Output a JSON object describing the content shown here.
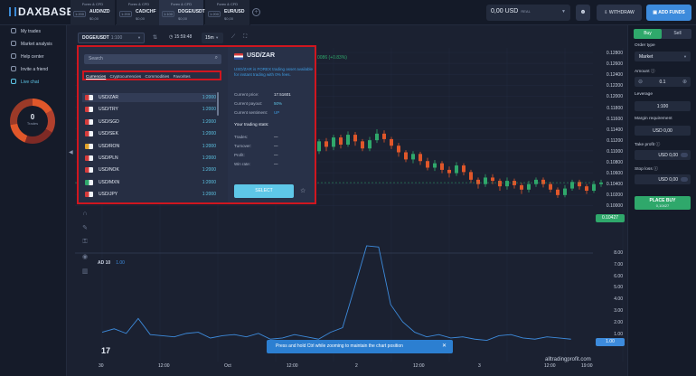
{
  "brand": {
    "logo_text": "DAXBASE"
  },
  "asset_tabs": [
    {
      "category": "Forex & CFD",
      "leverage": "1:200",
      "name": "AUD/NZD",
      "amount": "$0,00",
      "active": false
    },
    {
      "category": "Forex & CFD",
      "leverage": "1:200",
      "name": "CAD/CHF",
      "amount": "$0,00",
      "active": false
    },
    {
      "category": "Forex & CFD",
      "leverage": "1:100",
      "name": "DOGE/USDT",
      "amount": "$0,00",
      "active": true
    },
    {
      "category": "Forex & CFD",
      "leverage": "1:200",
      "name": "EUR/USD",
      "amount": "$0,00",
      "active": false
    }
  ],
  "header": {
    "balance": "0,00 USD",
    "balance_type": "REAL",
    "withdraw_label": "WITHDRAW",
    "add_funds_label": "ADD FUNDS"
  },
  "leftnav": {
    "items": [
      {
        "label": "My trades",
        "icon": "briefcase-icon"
      },
      {
        "label": "Market analysis",
        "icon": "chart-icon"
      },
      {
        "label": "Help center",
        "icon": "question-icon"
      },
      {
        "label": "Invite a friend",
        "icon": "user-plus-icon"
      },
      {
        "label": "Live chat",
        "icon": "chat-icon"
      }
    ],
    "trades_count": "0",
    "trades_label": "Trades"
  },
  "chart": {
    "pair_select": "DOGE/USDT",
    "pair_leverage": "1:100",
    "clock": "15:59:48",
    "timeframe": "15m",
    "price_ticks": [
      "0.12800",
      "0.12600",
      "0.12400",
      "0.12200",
      "0.12000",
      "0.11800",
      "0.11600",
      "0.11400",
      "0.11200",
      "0.11000",
      "0.10800",
      "0.10600",
      "0.10400",
      "0.10200",
      "0.10000"
    ],
    "price_badge": "0.10427",
    "ad_ticks": [
      "8.00",
      "7.00",
      "6.00",
      "5.00",
      "4.00",
      "3.00",
      "2.00",
      "1.00",
      "0.00"
    ],
    "ad_badge": "1.00",
    "ad_label": "AD 10",
    "ad_value": "1.00",
    "top_value": "0086 (+0.83%)",
    "time_ticks": [
      "30",
      "12:00",
      "Oct",
      "12:00",
      "2",
      "12:00",
      "3",
      "12:00",
      "19:00"
    ],
    "toast": "Press and hold Ctrl while zooming to maintain the chart position",
    "watermark": "alltradingprofit.com",
    "candles": [
      [
        0.11,
        0.1118,
        0.1122,
        0.1095
      ],
      [
        0.1118,
        0.1108,
        0.1124,
        0.11
      ],
      [
        0.1108,
        0.1125,
        0.113,
        0.1102
      ],
      [
        0.1125,
        0.1112,
        0.113,
        0.1105
      ],
      [
        0.1112,
        0.113,
        0.1136,
        0.1108
      ],
      [
        0.113,
        0.1118,
        0.1135,
        0.111
      ],
      [
        0.1118,
        0.1105,
        0.1122,
        0.11
      ],
      [
        0.1105,
        0.112,
        0.1126,
        0.11
      ],
      [
        0.112,
        0.1132,
        0.114,
        0.1115
      ],
      [
        0.1132,
        0.1122,
        0.1138,
        0.1116
      ],
      [
        0.1122,
        0.111,
        0.1126,
        0.1104
      ],
      [
        0.111,
        0.1098,
        0.1115,
        0.109
      ],
      [
        0.1098,
        0.1085,
        0.1102,
        0.108
      ],
      [
        0.1085,
        0.1095,
        0.11,
        0.1078
      ],
      [
        0.1095,
        0.1082,
        0.1099,
        0.1075
      ],
      [
        0.1082,
        0.107,
        0.1088,
        0.1065
      ],
      [
        0.107,
        0.1078,
        0.1084,
        0.1064
      ],
      [
        0.1078,
        0.1066,
        0.1082,
        0.106
      ],
      [
        0.1066,
        0.106,
        0.1072,
        0.1052
      ],
      [
        0.106,
        0.1074,
        0.108,
        0.1055
      ],
      [
        0.1074,
        0.1062,
        0.1078,
        0.1056
      ],
      [
        0.1062,
        0.1048,
        0.1066,
        0.1042
      ],
      [
        0.1048,
        0.104,
        0.1052,
        0.1032
      ],
      [
        0.104,
        0.1052,
        0.1058,
        0.1035
      ],
      [
        0.1052,
        0.1046,
        0.1058,
        0.104
      ],
      [
        0.1046,
        0.1036,
        0.105,
        0.1028
      ],
      [
        0.1036,
        0.1046,
        0.1052,
        0.103
      ],
      [
        0.1046,
        0.1038,
        0.105,
        0.1032
      ],
      [
        0.1038,
        0.103,
        0.1042,
        0.1022
      ],
      [
        0.103,
        0.104,
        0.1046,
        0.1025
      ],
      [
        0.104,
        0.1048,
        0.1052,
        0.1035
      ],
      [
        0.1048,
        0.104,
        0.1052,
        0.1034
      ],
      [
        0.104,
        0.103,
        0.1044,
        0.1025
      ],
      [
        0.103,
        0.102,
        0.1034,
        0.1015
      ],
      [
        0.102,
        0.1032,
        0.1038,
        0.1016
      ],
      [
        0.1032,
        0.1044,
        0.1048,
        0.1028
      ],
      [
        0.1044,
        0.1036,
        0.1048,
        0.103
      ],
      [
        0.1036,
        0.1028,
        0.104,
        0.1022
      ],
      [
        0.1028,
        0.104,
        0.1046,
        0.1024
      ],
      [
        0.104,
        0.1043,
        0.1048,
        0.1035
      ]
    ],
    "ad_series": [
      1.6,
      1.9,
      1.5,
      2.8,
      1.4,
      1.3,
      1.2,
      1.5,
      1.6,
      1.1,
      1.3,
      1.4,
      1.2,
      1.5,
      1.0,
      1.1,
      1.4,
      1.2,
      1.0,
      1.6,
      2.0,
      5.5,
      9.1,
      9.0,
      4.0,
      2.5,
      1.6,
      1.2,
      1.4,
      1.1,
      1.2,
      1.0,
      0.9,
      1.3,
      1.4,
      1.1,
      1.0,
      1.2,
      1.1,
      1.0
    ]
  },
  "picker": {
    "search_placeholder": "Search",
    "tabs": [
      {
        "label": "Currencies",
        "active": true
      },
      {
        "label": "Cryptocurrencies",
        "active": false
      },
      {
        "label": "Commodities",
        "active": false
      },
      {
        "label": "Favorites",
        "active": false
      }
    ],
    "rows": [
      {
        "pair": "USD/ZAR",
        "leverage": "1:2000",
        "selected": true,
        "flag_color": "#d63b3b"
      },
      {
        "pair": "USD/TRY",
        "leverage": "1:2000",
        "selected": false,
        "flag_color": "#d63b3b"
      },
      {
        "pair": "USD/SGD",
        "leverage": "1:2000",
        "selected": false,
        "flag_color": "#d63b3b"
      },
      {
        "pair": "USD/SEK",
        "leverage": "1:2000",
        "selected": false,
        "flag_color": "#d63b3b"
      },
      {
        "pair": "USD/RON",
        "leverage": "1:2000",
        "selected": false,
        "flag_color": "#e0a22a"
      },
      {
        "pair": "USD/PLN",
        "leverage": "1:2000",
        "selected": false,
        "flag_color": "#d63b3b"
      },
      {
        "pair": "USD/NOK",
        "leverage": "1:2000",
        "selected": false,
        "flag_color": "#d63b3b"
      },
      {
        "pair": "USD/MXN",
        "leverage": "1:2000",
        "selected": false,
        "flag_color": "#2fa86b"
      },
      {
        "pair": "USD/JPY",
        "leverage": "1:2000",
        "selected": false,
        "flag_color": "#d63b3b"
      }
    ],
    "detail": {
      "title": "USD/ZAR",
      "description": "USD/ZAR is FOREX trading asset available for instant trading with 0% fees.",
      "current_price_label": "Current price:",
      "current_price": "17.51601",
      "current_payout_label": "Current payout:",
      "current_payout": "50%",
      "current_sentiment_label": "Current sentiment:",
      "current_sentiment": "UP",
      "stats_title": "Your trading stats:",
      "trades_label": "Trades:",
      "trades_value": "—",
      "turnover_label": "Turnover:",
      "turnover_value": "—",
      "profit_label": "Profit:",
      "profit_value": "—",
      "winrate_label": "Win rate:",
      "winrate_value": "—",
      "select_label": "SELECT"
    }
  },
  "rightpanel": {
    "buy_label": "Buy",
    "sell_label": "Sell",
    "order_type_label": "Order type",
    "order_type_value": "Market",
    "amount_label": "Amount",
    "amount_value": "0.1",
    "leverage_label": "Leverage",
    "leverage_value": "1:100",
    "margin_label": "Margin requirement",
    "margin_value": "USD 0,00",
    "take_profit_label": "Take profit",
    "take_profit_value": "USD 0,00",
    "stop_loss_label": "Stop loss",
    "stop_loss_value": "USD 0,00",
    "place_buy_label": "PLACE BUY",
    "place_buy_price": "0,10427"
  },
  "colors": {
    "accent": "#3d8bdc",
    "buy": "#2fa86b",
    "sell": "#e0572a",
    "highlight_box": "#d0161f"
  }
}
